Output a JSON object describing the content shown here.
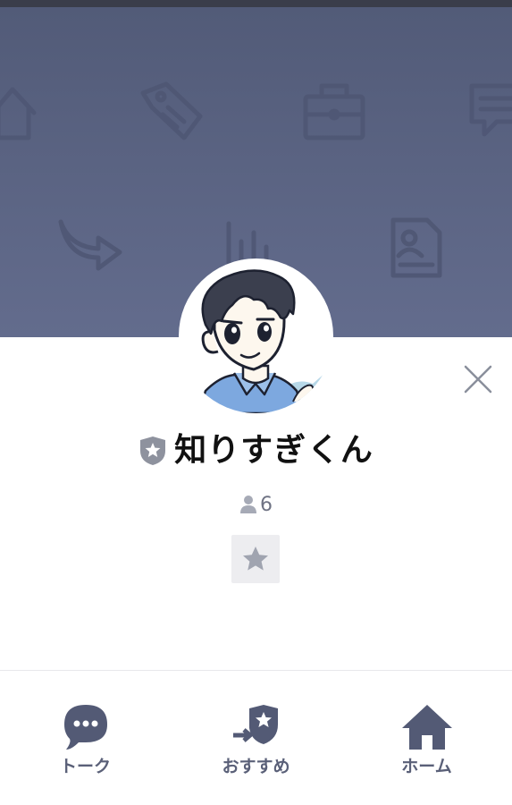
{
  "profile": {
    "name": "知りすぎくん",
    "friend_count": "6"
  },
  "bottom_nav": {
    "items": [
      {
        "label": "トーク",
        "icon": "chat-bubble-icon"
      },
      {
        "label": "おすすめ",
        "icon": "recommend-badge-icon"
      },
      {
        "label": "ホーム",
        "icon": "home-icon"
      }
    ]
  },
  "colors": {
    "cover_top": "#525b78",
    "cover_bottom": "#636c8d",
    "nav_icon": "#535a75",
    "name_text": "#111111",
    "muted_text": "#6e7283"
  }
}
